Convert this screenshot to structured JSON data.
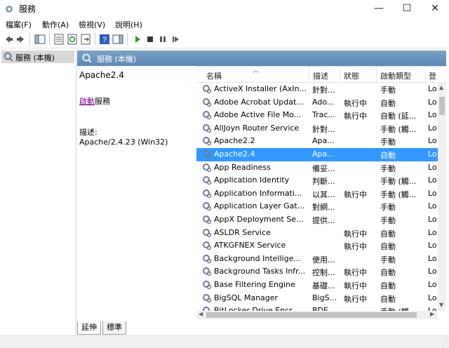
{
  "window": {
    "title": "服務",
    "app_icon": "gear-icon",
    "minimize": "—",
    "maximize": "☐",
    "close": "✕"
  },
  "menu": [
    {
      "label": "檔案(F)"
    },
    {
      "label": "動作(A)"
    },
    {
      "label": "檢視(V)"
    },
    {
      "label": "說明(H)"
    }
  ],
  "toolbar_icons": [
    "back-icon",
    "forward-icon",
    "show-hide-tree-icon",
    "properties-icon",
    "refresh-icon",
    "export-icon",
    "help-icon",
    "show-hide-action-icon",
    "play-icon",
    "stop-icon",
    "pause-icon",
    "restart-icon"
  ],
  "tree": {
    "label": "服務 (本機)"
  },
  "panel": {
    "header": "服務 (本機)",
    "selected_title": "Apache2.4",
    "action_link": "啟動",
    "action_suffix": "服務",
    "desc_label": "描述:",
    "desc_text": "Apache/2.4.23 (Win32)"
  },
  "columns": {
    "name": "名稱",
    "desc": "描述",
    "status": "狀態",
    "start": "啟動類型",
    "logon": "登"
  },
  "rows": [
    {
      "name": "ActiveX Installer (AxIn...",
      "desc": "針對...",
      "status": "",
      "start": "手動",
      "logon": "Lo"
    },
    {
      "name": "Adobe Acrobat Updat...",
      "desc": "Ado...",
      "status": "執行中",
      "start": "自動",
      "logon": "Lo"
    },
    {
      "name": "Adobe Active File Mo...",
      "desc": "Trac...",
      "status": "執行中",
      "start": "自動 (延...",
      "logon": "Lo"
    },
    {
      "name": "AllJoyn Router Service",
      "desc": "針對...",
      "status": "",
      "start": "手動 (觸...",
      "logon": "Lo"
    },
    {
      "name": "Apache2.2",
      "desc": "Apa...",
      "status": "",
      "start": "手動",
      "logon": "Lo"
    },
    {
      "name": "Apache2.4",
      "desc": "Apa...",
      "status": "",
      "start": "自動",
      "logon": "Lo",
      "selected": true
    },
    {
      "name": "App Readiness",
      "desc": "備妥...",
      "status": "",
      "start": "手動",
      "logon": "Lo"
    },
    {
      "name": "Application Identity",
      "desc": "判斷...",
      "status": "",
      "start": "手動 (觸...",
      "logon": "Lo"
    },
    {
      "name": "Application Informati...",
      "desc": "以其...",
      "status": "執行中",
      "start": "手動 (觸...",
      "logon": "Lo"
    },
    {
      "name": "Application Layer Gat...",
      "desc": "對網...",
      "status": "",
      "start": "手動",
      "logon": "Lo"
    },
    {
      "name": "AppX Deployment Se...",
      "desc": "提供...",
      "status": "",
      "start": "手動",
      "logon": "Lo"
    },
    {
      "name": "ASLDR Service",
      "desc": "",
      "status": "執行中",
      "start": "自動",
      "logon": "Lo"
    },
    {
      "name": "ATKGFNEX Service",
      "desc": "",
      "status": "執行中",
      "start": "自動",
      "logon": "Lo"
    },
    {
      "name": "Background Intellige...",
      "desc": "使用...",
      "status": "",
      "start": "手動",
      "logon": "Lo"
    },
    {
      "name": "Background Tasks Infr...",
      "desc": "控制...",
      "status": "執行中",
      "start": "自動",
      "logon": "Lo"
    },
    {
      "name": "Base Filtering Engine",
      "desc": "基礎...",
      "status": "執行中",
      "start": "自動",
      "logon": "Lo"
    },
    {
      "name": "BigSQL Manager",
      "desc": "BigS...",
      "status": "執行中",
      "start": "自動",
      "logon": "Lo"
    },
    {
      "name": "BitLocker Drive Encr...",
      "desc": "BDE...",
      "status": "",
      "start": "手動 (觸...",
      "logon": "Lo"
    }
  ],
  "tabs": [
    {
      "label": "延伸",
      "active": true
    },
    {
      "label": "標準",
      "active": false
    }
  ],
  "colors": {
    "selection": "#3399ff",
    "header_top": "#7aa3c8",
    "header_bottom": "#5d88b3",
    "link": "#800080"
  }
}
